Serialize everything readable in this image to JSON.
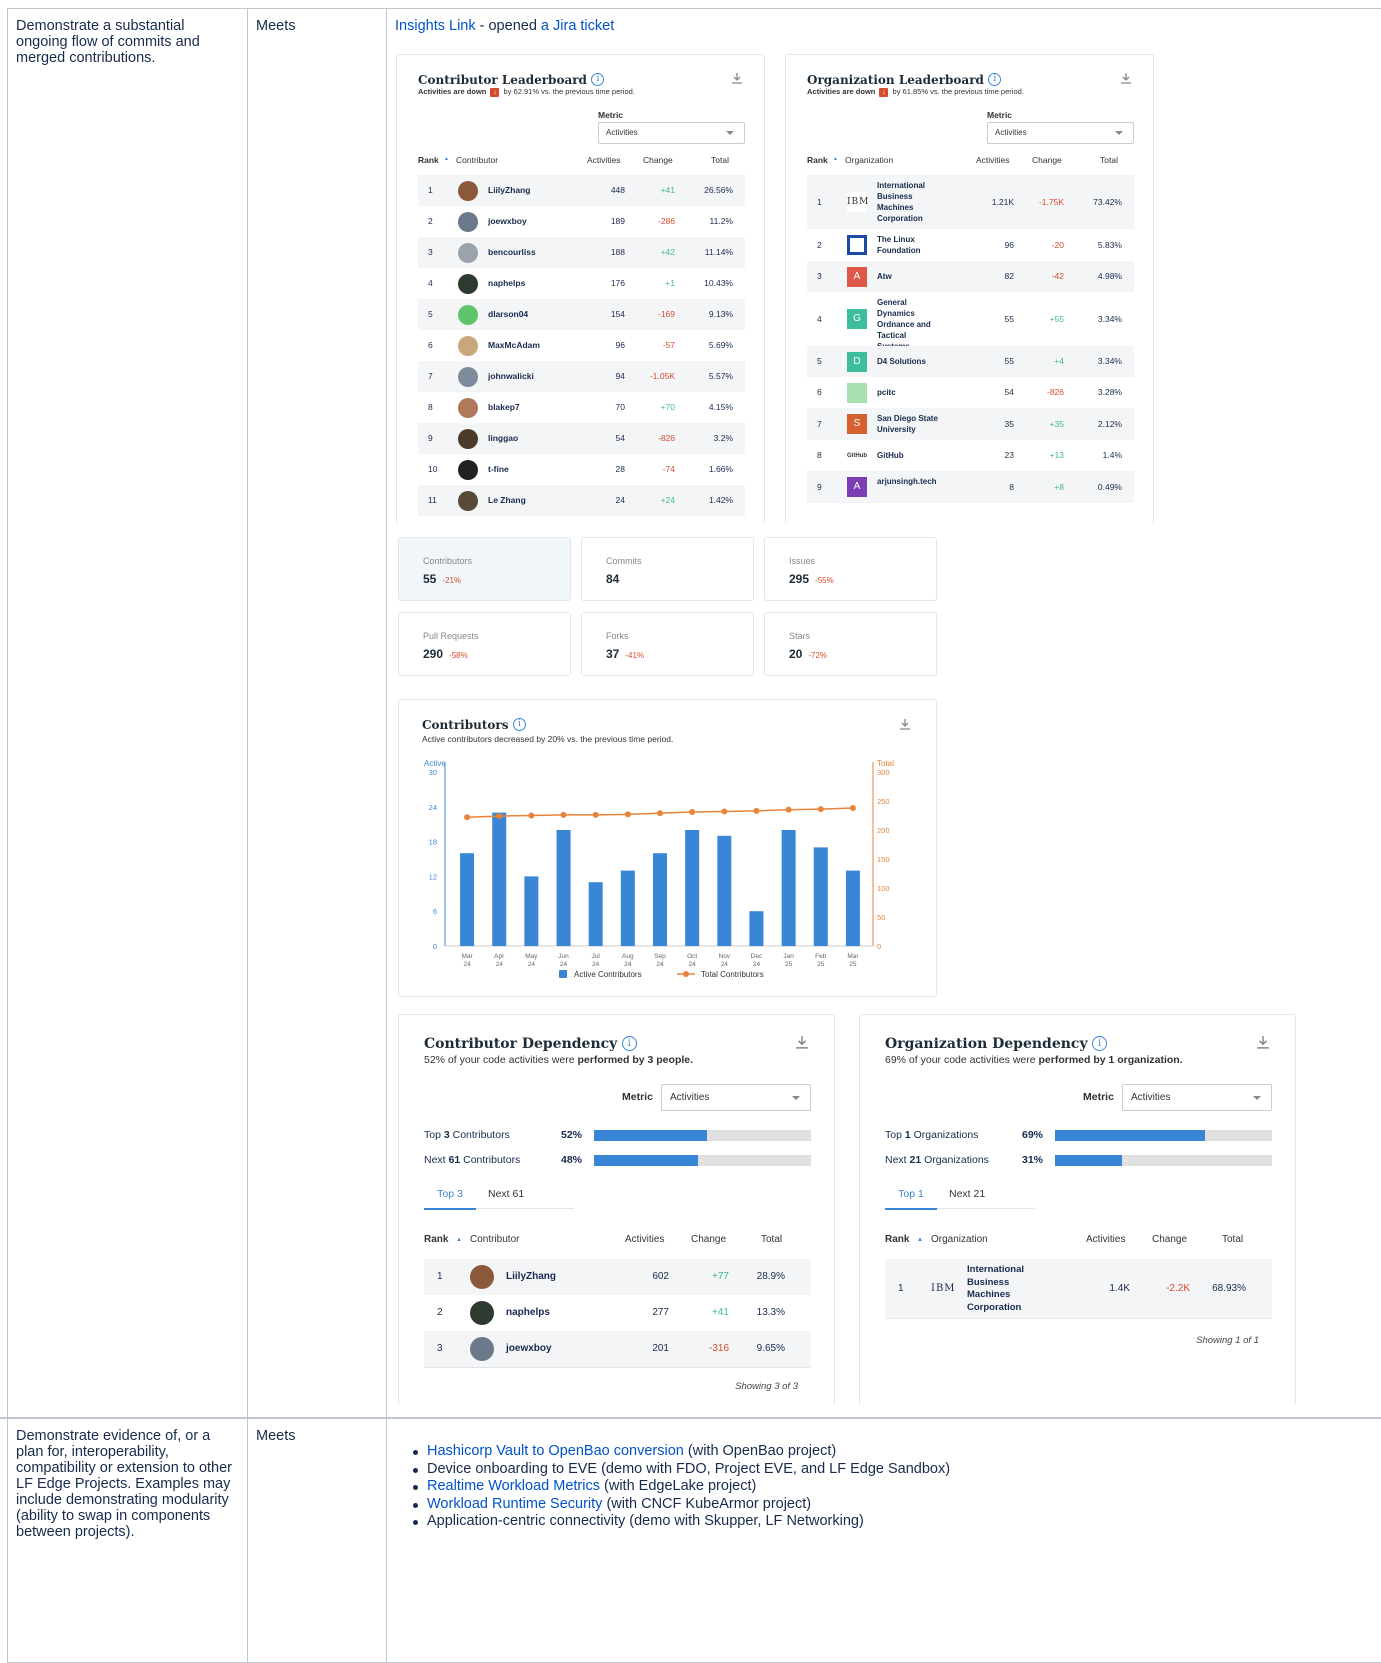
{
  "row1": {
    "criterion": "Demonstrate a substantial ongoing flow of commits and merged contributions.",
    "status": "Meets",
    "evidence_link1": "Insights Link",
    "evidence_mid": " - opened ",
    "evidence_link2": "a Jira ticket"
  },
  "contrib_lb": {
    "title": "Contributor Leaderboard",
    "sub_bold": "Activities are down",
    "sub_rest": "by 62.91% vs. the previous time period.",
    "metric_label": "Metric",
    "metric_value": "Activities",
    "headers": [
      "Rank",
      "Contributor",
      "Activities",
      "Change",
      "Total"
    ],
    "rows": [
      {
        "rank": "1",
        "name": "LiilyZhang",
        "act": "448",
        "chg": "+41",
        "total": "26.56%"
      },
      {
        "rank": "2",
        "name": "joewxboy",
        "act": "189",
        "chg": "-286",
        "total": "11.2%"
      },
      {
        "rank": "3",
        "name": "bencourliss",
        "act": "188",
        "chg": "+42",
        "total": "11.14%"
      },
      {
        "rank": "4",
        "name": "naphelps",
        "act": "176",
        "chg": "+1",
        "total": "10.43%"
      },
      {
        "rank": "5",
        "name": "dlarson04",
        "act": "154",
        "chg": "-169",
        "total": "9.13%"
      },
      {
        "rank": "6",
        "name": "MaxMcAdam",
        "act": "96",
        "chg": "-57",
        "total": "5.69%"
      },
      {
        "rank": "7",
        "name": "johnwalicki",
        "act": "94",
        "chg": "-1.05K",
        "total": "5.57%"
      },
      {
        "rank": "8",
        "name": "blakep7",
        "act": "70",
        "chg": "+70",
        "total": "4.15%"
      },
      {
        "rank": "9",
        "name": "linggao",
        "act": "54",
        "chg": "-826",
        "total": "3.2%"
      },
      {
        "rank": "10",
        "name": "t-fine",
        "act": "28",
        "chg": "-74",
        "total": "1.66%"
      },
      {
        "rank": "11",
        "name": "Le Zhang",
        "act": "24",
        "chg": "+24",
        "total": "1.42%"
      }
    ]
  },
  "org_lb": {
    "title": "Organization Leaderboard",
    "sub_bold": "Activities are down",
    "sub_rest": "by 61.85% vs. the previous time period.",
    "metric_label": "Metric",
    "metric_value": "Activities",
    "headers": [
      "Rank",
      "Organization",
      "Activities",
      "Change",
      "Total"
    ],
    "rows": [
      {
        "rank": "1",
        "name": "International Business Machines Corporation",
        "logo": "IBM",
        "act": "1.21K",
        "chg": "-1.75K",
        "total": "73.42%"
      },
      {
        "rank": "2",
        "name": "The Linux Foundation",
        "logo": "",
        "act": "96",
        "chg": "-20",
        "total": "5.83%"
      },
      {
        "rank": "3",
        "name": "Atw",
        "logo": "A",
        "act": "82",
        "chg": "-42",
        "total": "4.98%"
      },
      {
        "rank": "4",
        "name": "General Dynamics Ordnance and Tactical Systems",
        "logo": "G",
        "act": "55",
        "chg": "+55",
        "total": "3.34%"
      },
      {
        "rank": "5",
        "name": "D4 Solutions",
        "logo": "D",
        "act": "55",
        "chg": "+4",
        "total": "3.34%"
      },
      {
        "rank": "6",
        "name": "pcitc",
        "logo": "",
        "act": "54",
        "chg": "-826",
        "total": "3.28%"
      },
      {
        "rank": "7",
        "name": "San Diego State University",
        "logo": "S",
        "act": "35",
        "chg": "+35",
        "total": "2.12%"
      },
      {
        "rank": "8",
        "name": "GitHub",
        "logo": "GitHub",
        "act": "23",
        "chg": "+13",
        "total": "1.4%"
      },
      {
        "rank": "9",
        "name": "arjunsingh.tech",
        "logo": "A",
        "act": "8",
        "chg": "+8",
        "total": "0.49%"
      }
    ]
  },
  "stats": [
    {
      "label": "Contributors",
      "value": "55",
      "change": "-21%"
    },
    {
      "label": "Commits",
      "value": "84",
      "change": ""
    },
    {
      "label": "Issues",
      "value": "295",
      "change": "-55%"
    },
    {
      "label": "Pull Requests",
      "value": "290",
      "change": "-58%"
    },
    {
      "label": "Forks",
      "value": "37",
      "change": "-41%"
    },
    {
      "label": "Stars",
      "value": "20",
      "change": "-72%"
    }
  ],
  "contributors_chart": {
    "title": "Contributors",
    "subtitle": "Active contributors decreased by 20% vs. the previous time period.",
    "legend_active": "Active Contributors",
    "legend_total": "Total Contributors"
  },
  "chart_data": {
    "type": "bar",
    "categories": [
      "Mar 24",
      "Apr 24",
      "May 24",
      "Jun 24",
      "Jul 24",
      "Aug 24",
      "Sep 24",
      "Oct 24",
      "Nov 24",
      "Dec 24",
      "Jan 25",
      "Feb 25",
      "Mar 25"
    ],
    "series": [
      {
        "name": "Active Contributors",
        "type": "bar",
        "axis": "left",
        "values": [
          16,
          23,
          12,
          20,
          11,
          13,
          16,
          20,
          19,
          6,
          20,
          17,
          13
        ]
      },
      {
        "name": "Total Contributors",
        "type": "line",
        "axis": "right",
        "values": [
          222,
          224,
          225,
          226,
          226,
          227,
          229,
          231,
          232,
          233,
          235,
          236,
          238
        ]
      }
    ],
    "ylabel": "Active",
    "y2label": "Total",
    "ylim": [
      0,
      30
    ],
    "y2lim": [
      0,
      300
    ],
    "yticks": [
      "0",
      "6",
      "12",
      "18",
      "24",
      "30"
    ],
    "y2ticks": [
      "0",
      "50",
      "100",
      "150",
      "200",
      "250",
      "300"
    ]
  },
  "contrib_dep": {
    "title": "Contributor Dependency",
    "sub_pre": "52% of your code activities were ",
    "sub_bold": "performed by 3 people.",
    "metric_label": "Metric",
    "metric_value": "Activities",
    "top_label_pre": "Top ",
    "top_label_num": "3",
    "top_label_post": " Contributors",
    "top_pct": "52%",
    "top_fill": 0.52,
    "next_label_pre": "Next ",
    "next_label_num": "61",
    "next_label_post": " Contributors",
    "next_pct": "48%",
    "next_fill": 0.48,
    "tab1": "Top 3",
    "tab2": "Next 61",
    "headers": [
      "Rank",
      "Contributor",
      "Activities",
      "Change",
      "Total"
    ],
    "rows": [
      {
        "rank": "1",
        "name": "LiilyZhang",
        "act": "602",
        "chg": "+77",
        "total": "28.9%"
      },
      {
        "rank": "2",
        "name": "naphelps",
        "act": "277",
        "chg": "+41",
        "total": "13.3%"
      },
      {
        "rank": "3",
        "name": "joewxboy",
        "act": "201",
        "chg": "-316",
        "total": "9.65%"
      }
    ],
    "showing": "Showing 3 of 3"
  },
  "org_dep": {
    "title": "Organization Dependency",
    "sub_pre": "69% of your code activities were ",
    "sub_bold": "performed by 1 organization.",
    "metric_label": "Metric",
    "metric_value": "Activities",
    "top_label_pre": "Top ",
    "top_label_num": "1",
    "top_label_post": " Organizations",
    "top_pct": "69%",
    "top_fill": 0.69,
    "next_label_pre": "Next ",
    "next_label_num": "21",
    "next_label_post": " Organizations",
    "next_pct": "31%",
    "next_fill": 0.31,
    "tab1": "Top 1",
    "tab2": "Next 21",
    "headers": [
      "Rank",
      "Organization",
      "Activities",
      "Change",
      "Total"
    ],
    "rows": [
      {
        "rank": "1",
        "name": "International Business Machines Corporation",
        "logo": "IBM",
        "act": "1.4K",
        "chg": "-2.2K",
        "total": "68.93%"
      }
    ],
    "showing": "Showing 1 of 1"
  },
  "row2": {
    "criterion": "Demonstrate evidence of, or a plan for, interoperability, compatibility or extension to other LF Edge Projects. Examples may include demonstrating modularity (ability to swap in components between projects).",
    "status": "Meets",
    "items": [
      {
        "link": "Hashicorp Vault to OpenBao conversion",
        "text": " (with OpenBao project)"
      },
      {
        "link": "",
        "text": "Device onboarding to EVE (demo with FDO, Project EVE, and LF Edge Sandbox)"
      },
      {
        "link": "Realtime Workload Metrics",
        "text": " (with EdgeLake project)"
      },
      {
        "link": "Workload Runtime Security",
        "text": " (with CNCF KubeArmor project)"
      },
      {
        "link": "",
        "text": "Application-centric connectivity (demo with Skupper, LF Networking)"
      }
    ]
  },
  "colors": {
    "accent": "#3a86d6",
    "line": "#e8833a",
    "positive": "#3dbd7d",
    "negative": "#d54c2b",
    "link": "#0052cc"
  }
}
